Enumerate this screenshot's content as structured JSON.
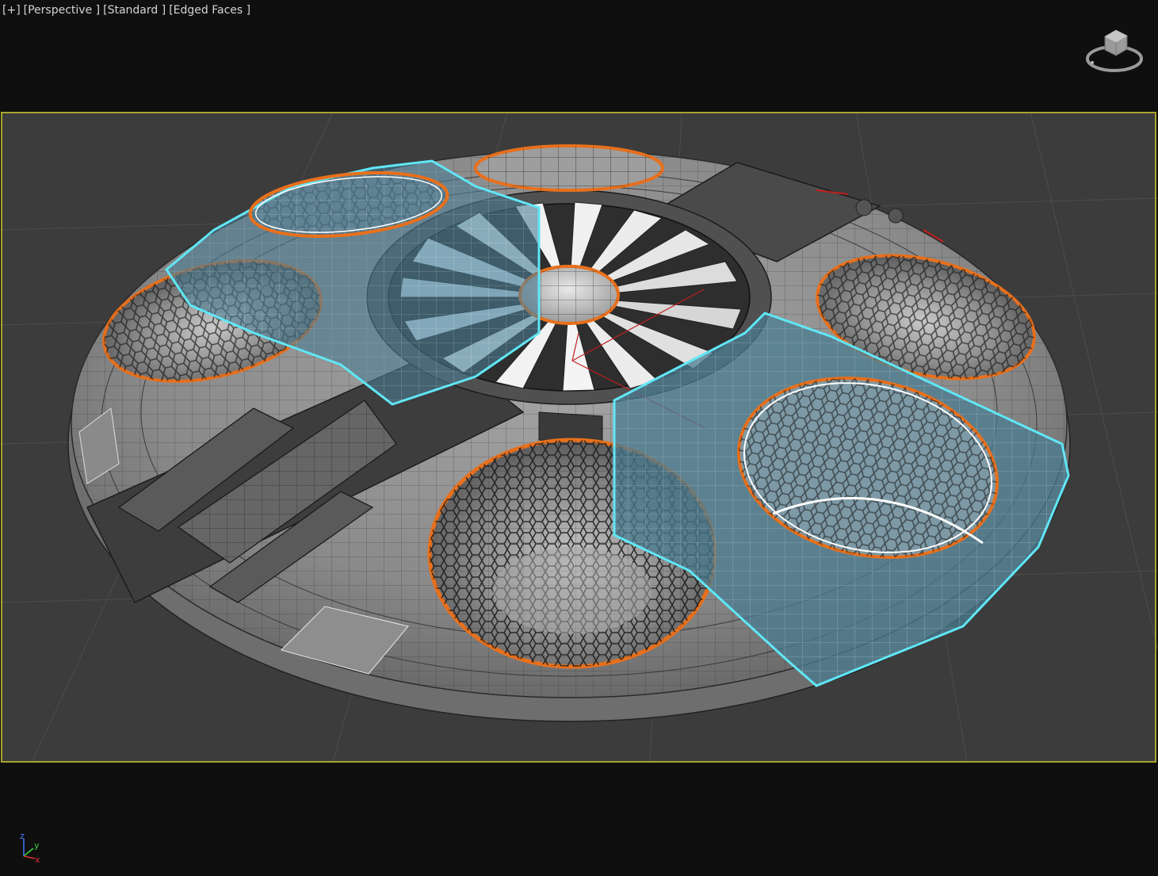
{
  "viewport": {
    "labels": {
      "plus": "[+]",
      "view": "[Perspective ]",
      "shading_style": "[Standard ]",
      "display_mode": "[Edged Faces ]"
    },
    "axis": {
      "x": "x",
      "y": "y",
      "z": "z"
    },
    "colors": {
      "background": "#0f0f0f",
      "grid_area": "#3c3c3c",
      "safe_frame": "#a8a32e",
      "selection": "#5fe6f5",
      "orange_trim": "#e8701c",
      "hull": "#8a8a8a"
    }
  }
}
